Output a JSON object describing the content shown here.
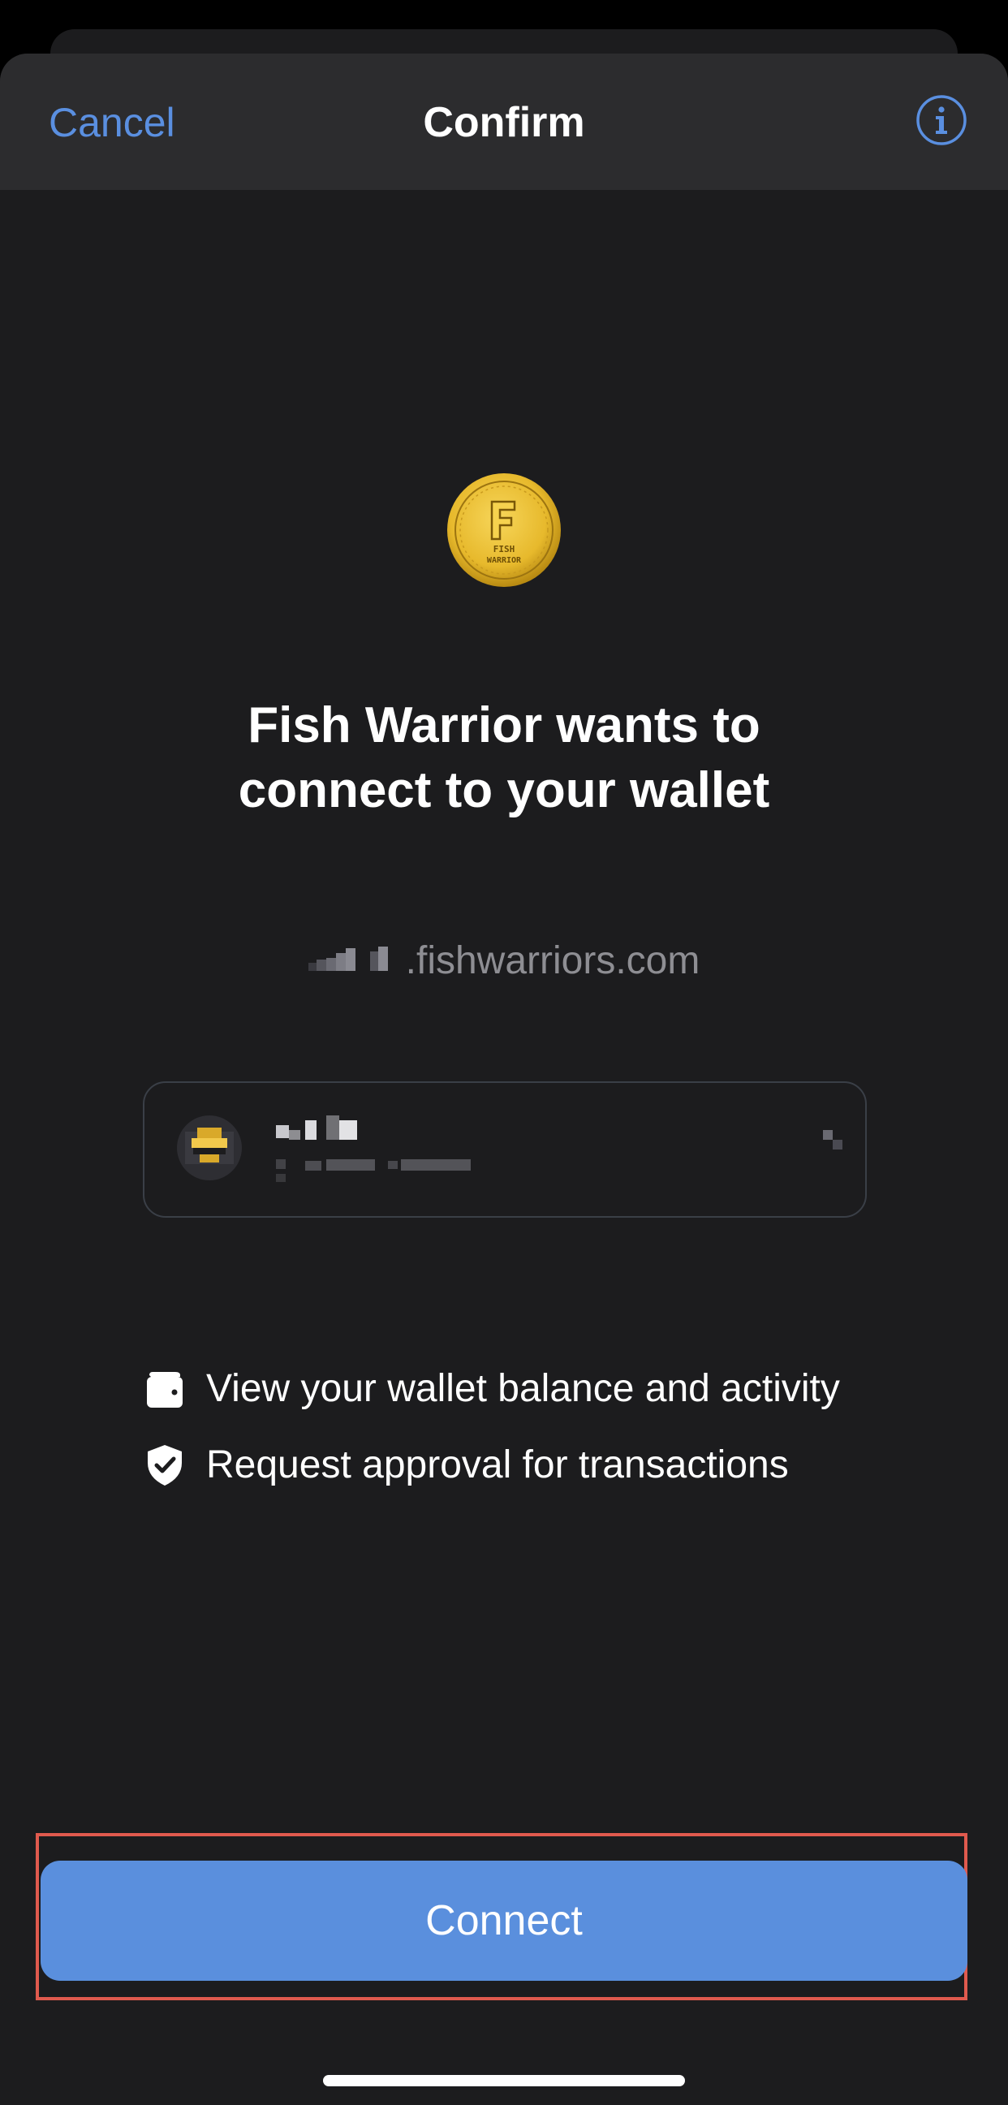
{
  "nav": {
    "cancel_label": "Cancel",
    "title": "Confirm",
    "info_icon": "info-circle-icon"
  },
  "dapp": {
    "logo_icon": "fish-warrior-coin-logo",
    "logo_text_top": "FISH",
    "logo_text_bottom": "WARRIOR",
    "headline_line1": "Fish Warrior wants to",
    "headline_line2": "connect to your wallet",
    "domain_suffix": ".fishwarriors.com"
  },
  "account": {
    "avatar_icon": "wallet-avatar-icon",
    "name_redacted": true,
    "address_redacted": true,
    "chevron_icon": "chevron-icon"
  },
  "permissions": [
    {
      "icon": "wallet-icon",
      "label": "View your wallet balance and activity"
    },
    {
      "icon": "shield-check-icon",
      "label": "Request approval for transactions"
    }
  ],
  "actions": {
    "connect_label": "Connect"
  },
  "colors": {
    "accent": "#5a8fdd",
    "link": "#5a8fe0",
    "background": "#1c1c1e",
    "navbar": "#2c2c2e",
    "highlight_frame": "#e05a4e",
    "secondary_text": "#8e8e93"
  }
}
